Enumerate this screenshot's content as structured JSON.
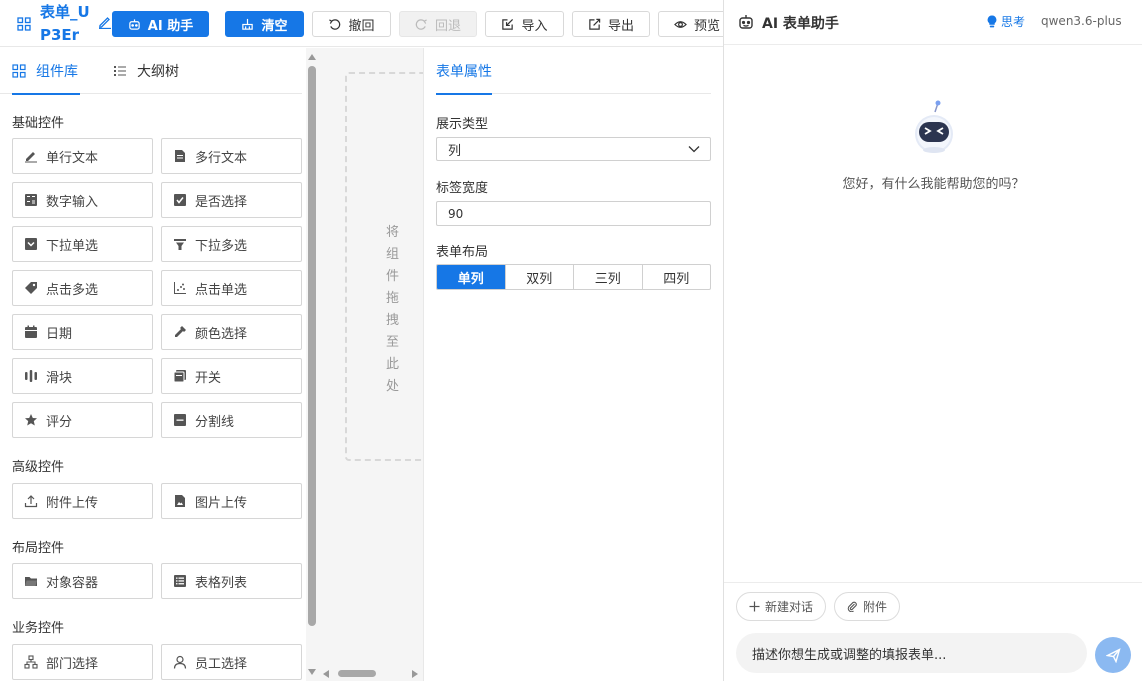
{
  "toolbar": {
    "form_title": "表单_UP3Er",
    "ai_assistant_label": "AI 助手",
    "clear_label": "清空",
    "undo_label": "撤回",
    "redo_label": "回退",
    "import_label": "导入",
    "export_label": "导出",
    "preview_label": "预览"
  },
  "left_panel": {
    "tabs": [
      "组件库",
      "大纲树"
    ],
    "active_tab": "组件库",
    "sections": {
      "basic": "基础控件",
      "advanced": "高级控件",
      "layout": "布局控件",
      "business": "业务控件"
    },
    "basic_components": [
      {
        "label": "单行文本",
        "icon": "pencil-icon"
      },
      {
        "label": "多行文本",
        "icon": "document-icon"
      },
      {
        "label": "数字输入",
        "icon": "calculator-icon"
      },
      {
        "label": "是否选择",
        "icon": "checkbox-icon"
      },
      {
        "label": "下拉单选",
        "icon": "dropdown-square-icon"
      },
      {
        "label": "下拉多选",
        "icon": "funnel-icon"
      },
      {
        "label": "点击多选",
        "icon": "tag-icon"
      },
      {
        "label": "点击单选",
        "icon": "scatter-icon"
      },
      {
        "label": "日期",
        "icon": "calendar-icon"
      },
      {
        "label": "颜色选择",
        "icon": "eyedropper-icon"
      },
      {
        "label": "滑块",
        "icon": "slider-icon"
      },
      {
        "label": "开关",
        "icon": "toggle-icon"
      },
      {
        "label": "评分",
        "icon": "star-icon"
      },
      {
        "label": "分割线",
        "icon": "divider-icon"
      }
    ],
    "advanced_components": [
      {
        "label": "附件上传",
        "icon": "upload-icon"
      },
      {
        "label": "图片上传",
        "icon": "image-file-icon"
      }
    ],
    "layout_components": [
      {
        "label": "对象容器",
        "icon": "folder-icon"
      },
      {
        "label": "表格列表",
        "icon": "table-list-icon"
      }
    ],
    "business_components": [
      {
        "label": "部门选择",
        "icon": "org-chart-icon"
      },
      {
        "label": "员工选择",
        "icon": "user-icon"
      }
    ]
  },
  "canvas": {
    "drop_hint": "将组件拖拽至此处"
  },
  "properties": {
    "tab_label": "表单属性",
    "display_type_label": "展示类型",
    "display_type_value": "列",
    "label_width_label": "标签宽度",
    "label_width_value": "90",
    "layout_label": "表单布局",
    "layout_options": [
      "单列",
      "双列",
      "三列",
      "四列"
    ],
    "layout_selected": "单列"
  },
  "ai_panel": {
    "title": "AI 表单助手",
    "think_label": "思考",
    "model_name": "qwen3.6-plus",
    "greeting": "您好，有什么我能帮助您的吗？",
    "new_chat_label": "新建对话",
    "attachment_label": "附件",
    "input_placeholder": "描述你想生成或调整的填报表单...",
    "send_button_color": "#8bb9f1"
  },
  "colors": {
    "accent": "#1677e6",
    "border": "#d6d6d6",
    "canvas_bg": "#f5f5f5"
  }
}
